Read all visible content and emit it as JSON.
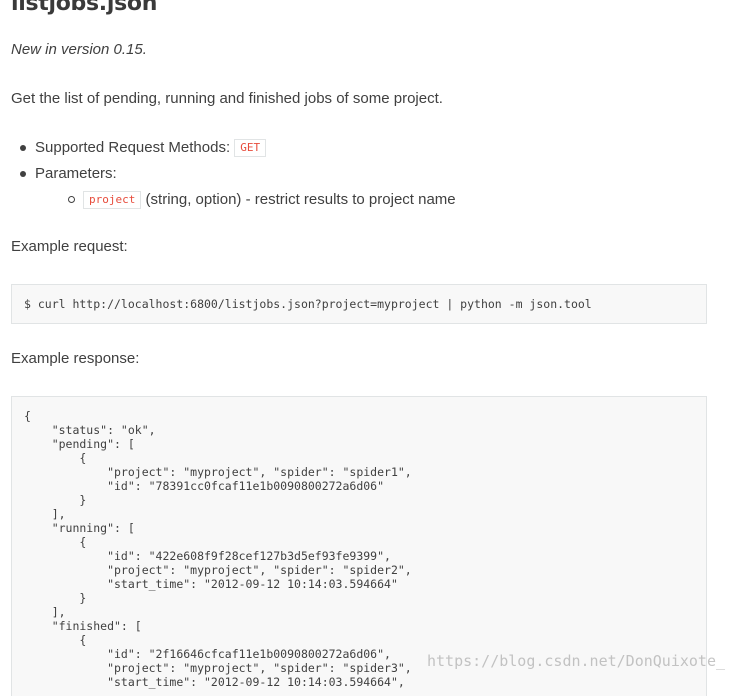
{
  "heading": "listjobs.json",
  "version_note": "New in version 0.15.",
  "description": "Get the list of pending, running and finished jobs of some project.",
  "bullets": {
    "methods_label": "Supported Request Methods:",
    "methods_value": "GET",
    "parameters_label": "Parameters:",
    "param_name": "project",
    "param_desc": "(string, option) - restrict results to project name"
  },
  "example_request_label": "Example request:",
  "example_request_code": "$ curl http://localhost:6800/listjobs.json?project=myproject | python -m json.tool",
  "example_response_label": "Example response:",
  "example_response_code": "{\n    \"status\": \"ok\",\n    \"pending\": [\n        {\n            \"project\": \"myproject\", \"spider\": \"spider1\",\n            \"id\": \"78391cc0fcaf11e1b0090800272a6d06\"\n        }\n    ],\n    \"running\": [\n        {\n            \"id\": \"422e608f9f28cef127b3d5ef93fe9399\",\n            \"project\": \"myproject\", \"spider\": \"spider2\",\n            \"start_time\": \"2012-09-12 10:14:03.594664\"\n        }\n    ],\n    \"finished\": [\n        {\n            \"id\": \"2f16646cfcaf11e1b0090800272a6d06\",\n            \"project\": \"myproject\", \"spider\": \"spider3\",\n            \"start_time\": \"2012-09-12 10:14:03.594664\",",
  "watermark": "https://blog.csdn.net/DonQuixote_",
  "colors": {
    "literal": "#e74c3c",
    "code_bg": "#f8f8f8",
    "border": "#e1e4e5",
    "text": "#404040"
  }
}
